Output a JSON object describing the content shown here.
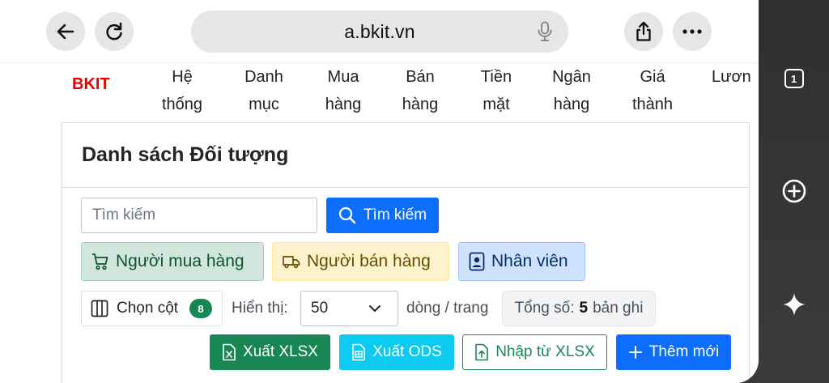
{
  "browser": {
    "url": "a.bkit.vn",
    "tab_count": "1"
  },
  "nav": {
    "brand": "BKIT",
    "items": [
      {
        "label": "Hệ\nthống"
      },
      {
        "label": "Danh\nmục"
      },
      {
        "label": "Mua\nhàng"
      },
      {
        "label": "Bán\nhàng"
      },
      {
        "label": "Tiền\nmặt"
      },
      {
        "label": "Ngân\nhàng"
      },
      {
        "label": "Giá\nthành"
      },
      {
        "label": "Lươn"
      }
    ]
  },
  "page": {
    "title": "Danh sách Đối tượng",
    "search_placeholder": "Tìm kiếm",
    "search_button": "Tìm kiếm",
    "filters": {
      "buyer": "Người mua hàng",
      "seller": "Người bán hàng",
      "staff": "Nhân viên"
    },
    "columns_button": "Chọn cột",
    "columns_count": "8",
    "show_label": "Hiển thị:",
    "page_size": "50",
    "rows_label": "dòng / trang",
    "total_label": "Tổng số:",
    "total_value": "5",
    "total_suffix": "bản ghi",
    "actions": {
      "export_xlsx": "Xuất XLSX",
      "export_ods": "Xuất ODS",
      "import_xlsx": "Nhập từ XLSX",
      "add_new": "Thêm mới"
    }
  },
  "colors": {
    "brand": "#e30000",
    "primary": "#0d6efd",
    "success": "#198754",
    "info": "#0dcaf0"
  }
}
